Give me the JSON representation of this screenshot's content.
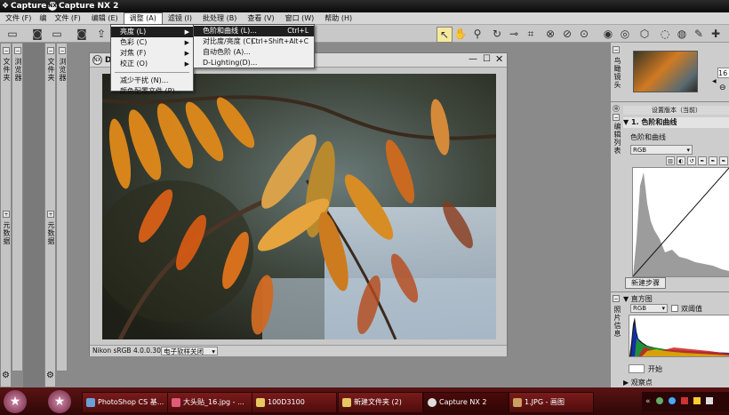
{
  "window": {
    "title": "Capture N",
    "app_name": "Capture NX 2",
    "logo": "NX"
  },
  "menubar": {
    "items": [
      {
        "label": "文件 (F)"
      },
      {
        "label": "编"
      },
      {
        "label": "文件 (F)"
      },
      {
        "label": "编辑 (E)"
      },
      {
        "label": "调整 (A)",
        "active": true
      },
      {
        "label": "滤镜 (I)"
      },
      {
        "label": "批处理 (B)"
      },
      {
        "label": "查看 (V)"
      },
      {
        "label": "窗口 (W)"
      },
      {
        "label": "帮助 (H)"
      }
    ]
  },
  "adjust_menu": {
    "items": [
      {
        "label": "亮度 (L)",
        "submenu": true,
        "highlighted": true
      },
      {
        "label": "色彩 (C)",
        "submenu": true
      },
      {
        "label": "对焦 (F)",
        "submenu": true
      },
      {
        "label": "校正 (O)",
        "submenu": true
      },
      {
        "label": "减少干扰 (N)..."
      },
      {
        "label": "颜色配置文件 (P)..."
      }
    ]
  },
  "brightness_submenu": {
    "items": [
      {
        "label": "色阶和曲线 (L)...",
        "shortcut": "Ctrl+L",
        "highlighted": true
      },
      {
        "label": "对比度/亮度 (C)...",
        "shortcut": "Ctrl+Shift+Alt+C"
      },
      {
        "label": "自动色阶 (A)..."
      },
      {
        "label": "D-Lighting(D)..."
      }
    ]
  },
  "left_panels": {
    "panel1": {
      "top_label": "文件夹",
      "bottom_label": "元数据"
    },
    "panel2": {
      "top_label": "浏览器",
      "bottom_label": "元数据"
    },
    "panel3": {
      "top_label": "浏览器"
    }
  },
  "image_window": {
    "title": "DS",
    "status_profile": "Nikon sRGB 4.0.0.3002",
    "softproof": "电子软样关闭"
  },
  "right_panel": {
    "birdseye_label": "鸟瞰镜头",
    "zoom_value": "16",
    "edit_list_label": "编辑列表",
    "edit_list_header": "设置版本（当前）",
    "step_title": "1. 色阶和曲线",
    "curve_group": "色阶和曲线",
    "channel": "RGB",
    "new_step_button": "新建步骤",
    "photo_info_label": "照片信息",
    "histogram_title": "直方图",
    "histogram_channel": "RGB",
    "dual_threshold": "双阈值",
    "start_label": "开始",
    "watch_point": "观察点"
  },
  "taskbar": {
    "tasks": [
      {
        "label": "PhotoShop CS 基...",
        "icon_color": "#6aa0d8"
      },
      {
        "label": "大头贴_16.jpg - ...",
        "icon_color": "#e05a7a"
      },
      {
        "label": "100D3100",
        "icon_color": "#e8c860"
      },
      {
        "label": "新建文件夹 (2)",
        "icon_color": "#e8c860"
      },
      {
        "label": "Capture NX 2",
        "icon_color": "#dddddd",
        "active": true
      },
      {
        "label": "1.JPG - 画图",
        "icon_color": "#c9a060"
      }
    ]
  },
  "colors": {
    "titlebar": "#111111",
    "taskbar": "#4a0e0e",
    "menu_highlight": "#1f1f1f",
    "tool_active": "#f5e9a0"
  }
}
